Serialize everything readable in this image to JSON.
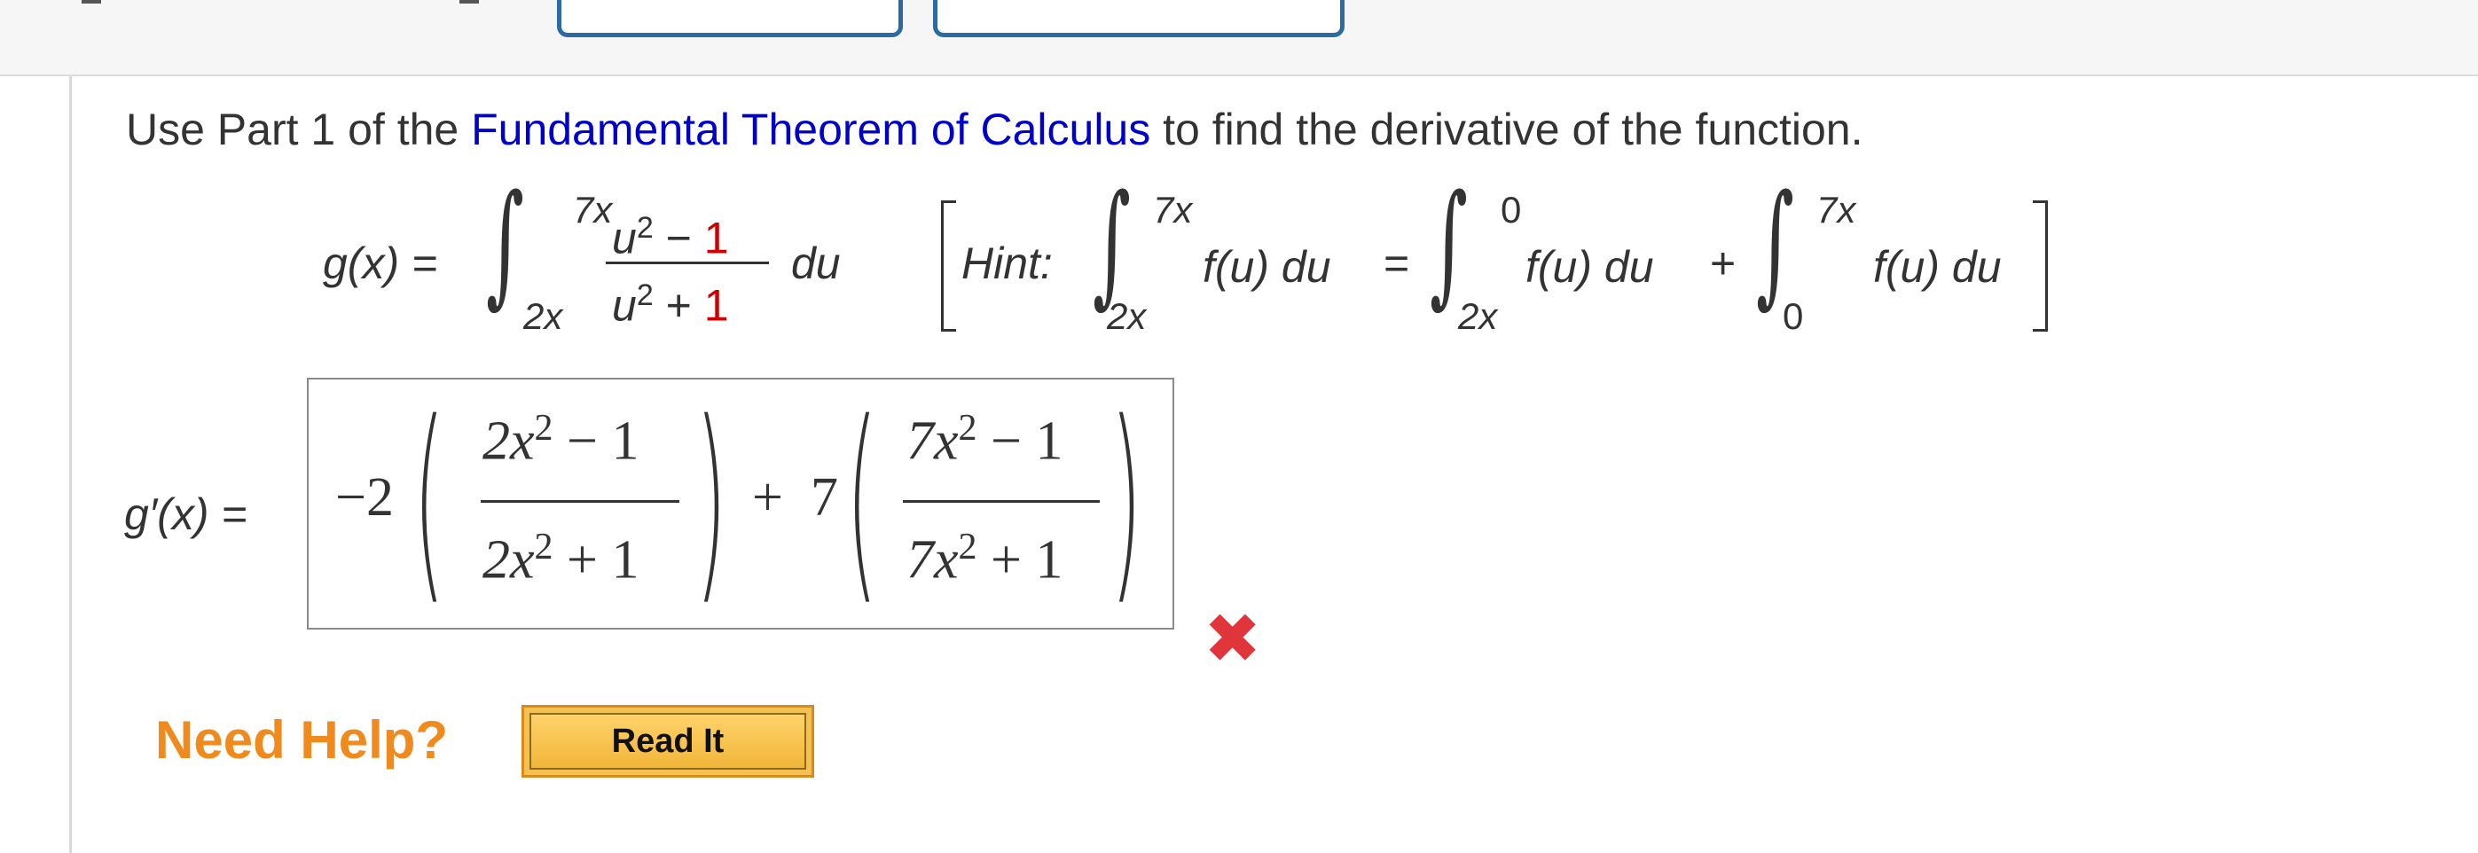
{
  "instruction": {
    "prefix": "Use Part 1 of the ",
    "link": "Fundamental Theorem of Calculus",
    "suffix": " to find the derivative of the function."
  },
  "function_def": {
    "lhs": "g(x) =",
    "upper": "7x",
    "lower": "2x",
    "num_var": "u",
    "num_exp": "2",
    "num_op": "−",
    "num_const": "1",
    "den_var": "u",
    "den_exp": "2",
    "den_op": "+",
    "den_const": "1",
    "differential": "du"
  },
  "hint": {
    "label": "Hint:",
    "int1_upper": "7x",
    "int1_lower": "2x",
    "body1": "f(u) du",
    "equals": "=",
    "int2_upper": "0",
    "int2_lower": "2x",
    "body2": "f(u) du",
    "plus": "+",
    "int3_upper": "7x",
    "int3_lower": "0",
    "body3": "f(u) du"
  },
  "answer": {
    "label": "g′(x) =",
    "coef1": "−2",
    "frac1_num": "2x",
    "frac1_num_exp": "2",
    "frac1_num_rest": "− 1",
    "frac1_den": "2x",
    "frac1_den_exp": "2",
    "frac1_den_rest": "+ 1",
    "plus": "+",
    "coef2": "7",
    "frac2_num": "7x",
    "frac2_num_exp": "2",
    "frac2_num_rest": "− 1",
    "frac2_den": "7x",
    "frac2_den_exp": "2",
    "frac2_den_rest": "+ 1",
    "status_icon": "x-mark-icon",
    "status": "incorrect"
  },
  "help": {
    "label": "Need Help?",
    "button": "Read It"
  },
  "colors": {
    "link": "#0000cc",
    "constant_red": "#cc0000",
    "incorrect_mark": "#e0353a",
    "need_help": "#f08a1c",
    "button_fill": "#f5c151",
    "tab_border": "#2c6aa4"
  }
}
